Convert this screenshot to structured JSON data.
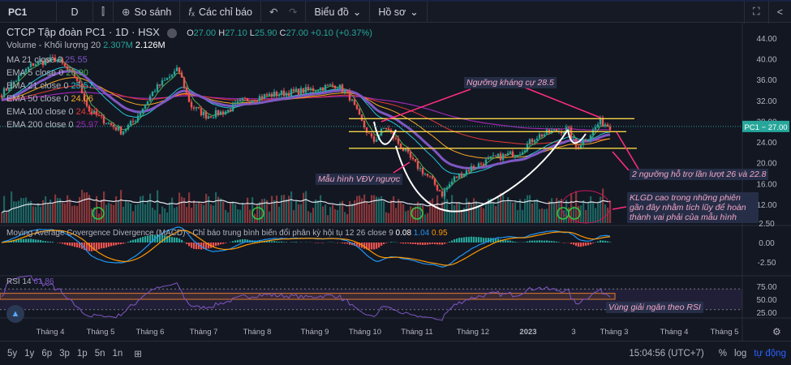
{
  "toolbar": {
    "symbol": "PC1",
    "interval": "D",
    "compare": "So sánh",
    "indicators": "Các chỉ báo",
    "chart_menu": "Biểu đồ",
    "profile_menu": "Hồ sơ"
  },
  "legend": {
    "title": "CTCP Tập đoàn PC1 · 1D · HSX",
    "o_label": "O",
    "o": "27.00",
    "h_label": "H",
    "h": "27.10",
    "l_label": "L",
    "l": "25.90",
    "c_label": "C",
    "c": "27.00",
    "change": "+0.10 (+0.37%)",
    "volume": {
      "label": "Volume - Khối lượng 20",
      "v1": "2.307M",
      "v2": "2.126M"
    },
    "mas": [
      {
        "label": "MA 21 close 0",
        "value": "25.55",
        "color": "#7e57c2"
      },
      {
        "label": "EMA 5 close 0",
        "value": "26.90",
        "color": "#4caf50"
      },
      {
        "label": "EMA 21 close 0",
        "value": "25.57",
        "color": "#26c6da"
      },
      {
        "label": "EMA 50 close 0",
        "value": "24.06",
        "color": "#f9a825"
      },
      {
        "label": "EMA 100 close 0",
        "value": "24.22",
        "color": "#e53935"
      },
      {
        "label": "EMA 200 close 0",
        "value": "25.97",
        "color": "#9c27b0"
      }
    ]
  },
  "macd": {
    "label": "Moving Average Covergence Divergence (MACD) - Chỉ báo trung bình biến đổi phân kỳ hội tụ 12 26 close 9",
    "v1": "0.08",
    "v2": "1.04",
    "v3": "0.95"
  },
  "rsi": {
    "label": "RSI 14",
    "value": "61.86"
  },
  "price_axis": [
    "44.00",
    "40.00",
    "36.00",
    "32.00",
    "28.00",
    "24.00",
    "20.00",
    "16.00",
    "12.00"
  ],
  "macd_axis": [
    "0.00",
    "-2.50"
  ],
  "rsi_axis": [
    "75.00",
    "50.00",
    "25.00"
  ],
  "price_tag": {
    "symbol": "PC1",
    "price": "27.00"
  },
  "time_axis": [
    "Tháng 4",
    "Tháng 5",
    "Tháng 6",
    "Tháng 7",
    "Tháng 8",
    "Tháng 9",
    "Tháng 10",
    "Tháng 11",
    "Tháng 12",
    "2023",
    "3",
    "Tháng 3",
    "Tháng 4",
    "Tháng 5"
  ],
  "annotations": {
    "resistance": "Ngưỡng kháng cự 28.5",
    "pattern": "Mẫu hình VĐV ngược",
    "supports": "2 ngưỡng hỗ trợ lần lượt 26 và 22.8",
    "volume_note": "KLGD cao trong những phiên gần đây nhằm tích lũy để hoàn thành vai phải của mẫu hình",
    "rsi_note": "Vùng giải ngân theo RSI"
  },
  "bottom": {
    "ranges": [
      "5y",
      "1y",
      "6p",
      "3p",
      "1p",
      "5n",
      "1n"
    ],
    "time": "15:04:56 (UTC+7)",
    "percent": "%",
    "log": "log",
    "auto": "tự động"
  },
  "chart_data": {
    "type": "candlestick",
    "levels": [
      28.5,
      26,
      22.8
    ],
    "price_path": [
      [
        0,
        33
      ],
      [
        40,
        39
      ],
      [
        70,
        40
      ],
      [
        95,
        36
      ],
      [
        110,
        30
      ],
      [
        150,
        26
      ],
      [
        165,
        28
      ],
      [
        190,
        34
      ],
      [
        220,
        38
      ],
      [
        235,
        31
      ],
      [
        255,
        29
      ],
      [
        280,
        30
      ],
      [
        300,
        32
      ],
      [
        330,
        33
      ],
      [
        380,
        34
      ],
      [
        415,
        35
      ],
      [
        430,
        33
      ],
      [
        445,
        28
      ],
      [
        460,
        24
      ],
      [
        475,
        27
      ],
      [
        490,
        24
      ],
      [
        510,
        20
      ],
      [
        530,
        17
      ],
      [
        545,
        14
      ],
      [
        560,
        17
      ],
      [
        580,
        19
      ],
      [
        610,
        21
      ],
      [
        640,
        22
      ],
      [
        660,
        25
      ],
      [
        680,
        26
      ],
      [
        700,
        26.5
      ],
      [
        710,
        23
      ],
      [
        725,
        25
      ],
      [
        740,
        28
      ],
      [
        752,
        27
      ]
    ]
  }
}
